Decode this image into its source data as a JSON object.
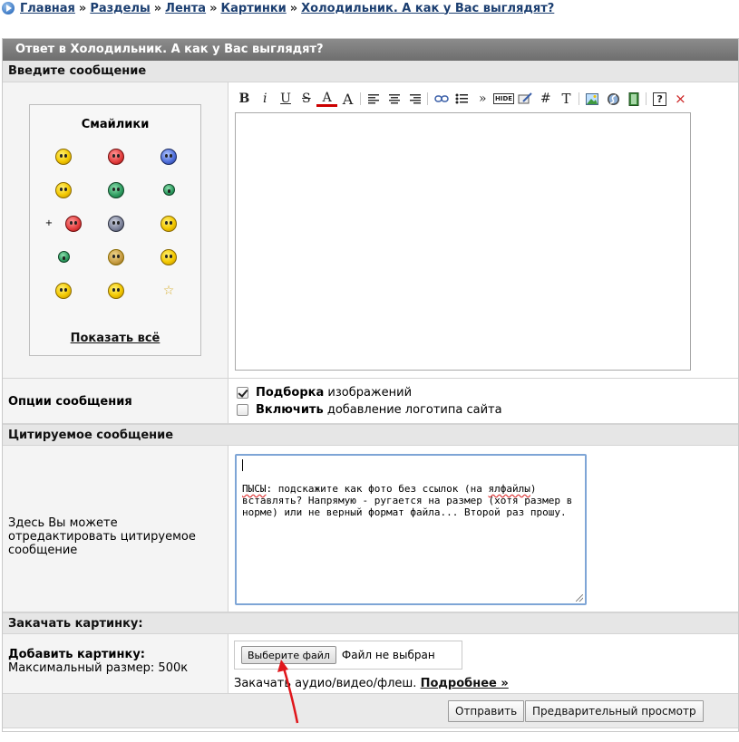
{
  "breadcrumb": [
    "Главная",
    "Разделы",
    "Лента",
    "Картинки",
    "Холодильник. А как у Вас выглядят?"
  ],
  "breadcrumb_sep": "»",
  "panel_title": "Ответ в Холодильник. А как у Вас выглядят?",
  "sections": {
    "message": "Введите сообщение",
    "quoted": "Цитируемое сообщение",
    "upload": "Закачать картинку:"
  },
  "smilies": {
    "title": "Смайлики",
    "show_all": "Показать всё",
    "items": [
      "cool-face",
      "in-love-face",
      "crying-face",
      "thinking-face",
      "shooting-face",
      "sick-face",
      "plus-sign",
      "gun-face",
      "sad-face",
      "dancing-face",
      "small-face",
      "hands-face",
      "shouting-face",
      "winner-face",
      "laughing-face",
      "star-icon"
    ]
  },
  "toolbar": [
    "bold",
    "italic",
    "underline",
    "strikethrough",
    "text-color",
    "font-size",
    "align-left",
    "align-center",
    "align-right",
    "link",
    "list",
    "quote",
    "hide",
    "edit",
    "hashtag",
    "text",
    "image",
    "flash",
    "video",
    "help",
    "close"
  ],
  "toolbar_labels": {
    "bold": "B",
    "italic": "i",
    "underline": "U",
    "strike": "S",
    "color": "A",
    "size": "A",
    "quote": "»",
    "hide": "HIDE",
    "hash": "#",
    "text": "T",
    "close": "×",
    "help": "?"
  },
  "options": {
    "label": "Опции сообщения",
    "items": [
      {
        "bold": "Подборка",
        "text": "изображений",
        "checked": true
      },
      {
        "bold": "Включить",
        "text": "добавление логотипа сайта",
        "checked": false
      }
    ]
  },
  "quote": {
    "label": "Здесь Вы можете отредактировать цитируемое сообщение",
    "author": "ПЫСЫ",
    "text_before": ": подскажите как фото без ссылок (на ",
    "typo": "ялфайлы",
    "text_after": ") вставлять? Напрямую - ругается на размер (хотя размер в норме) или не верный формат файла... Второй раз прошу."
  },
  "upload": {
    "label_bold": "Добавить картинку:",
    "label_hint": "Максимальный размер: 500к",
    "choose_button": "Выберите файл",
    "no_file": "Файл не выбран",
    "extra_text": "Закачать аудио/видео/флеш.",
    "extra_link": "Подробнее »"
  },
  "buttons": {
    "submit": "Отправить",
    "preview": "Предварительный просмотр"
  },
  "colors": {
    "title_bar": "#7a7a7a",
    "section_bg": "#e6e6e6",
    "link": "#1b3e70",
    "arrow": "#e0161b"
  }
}
